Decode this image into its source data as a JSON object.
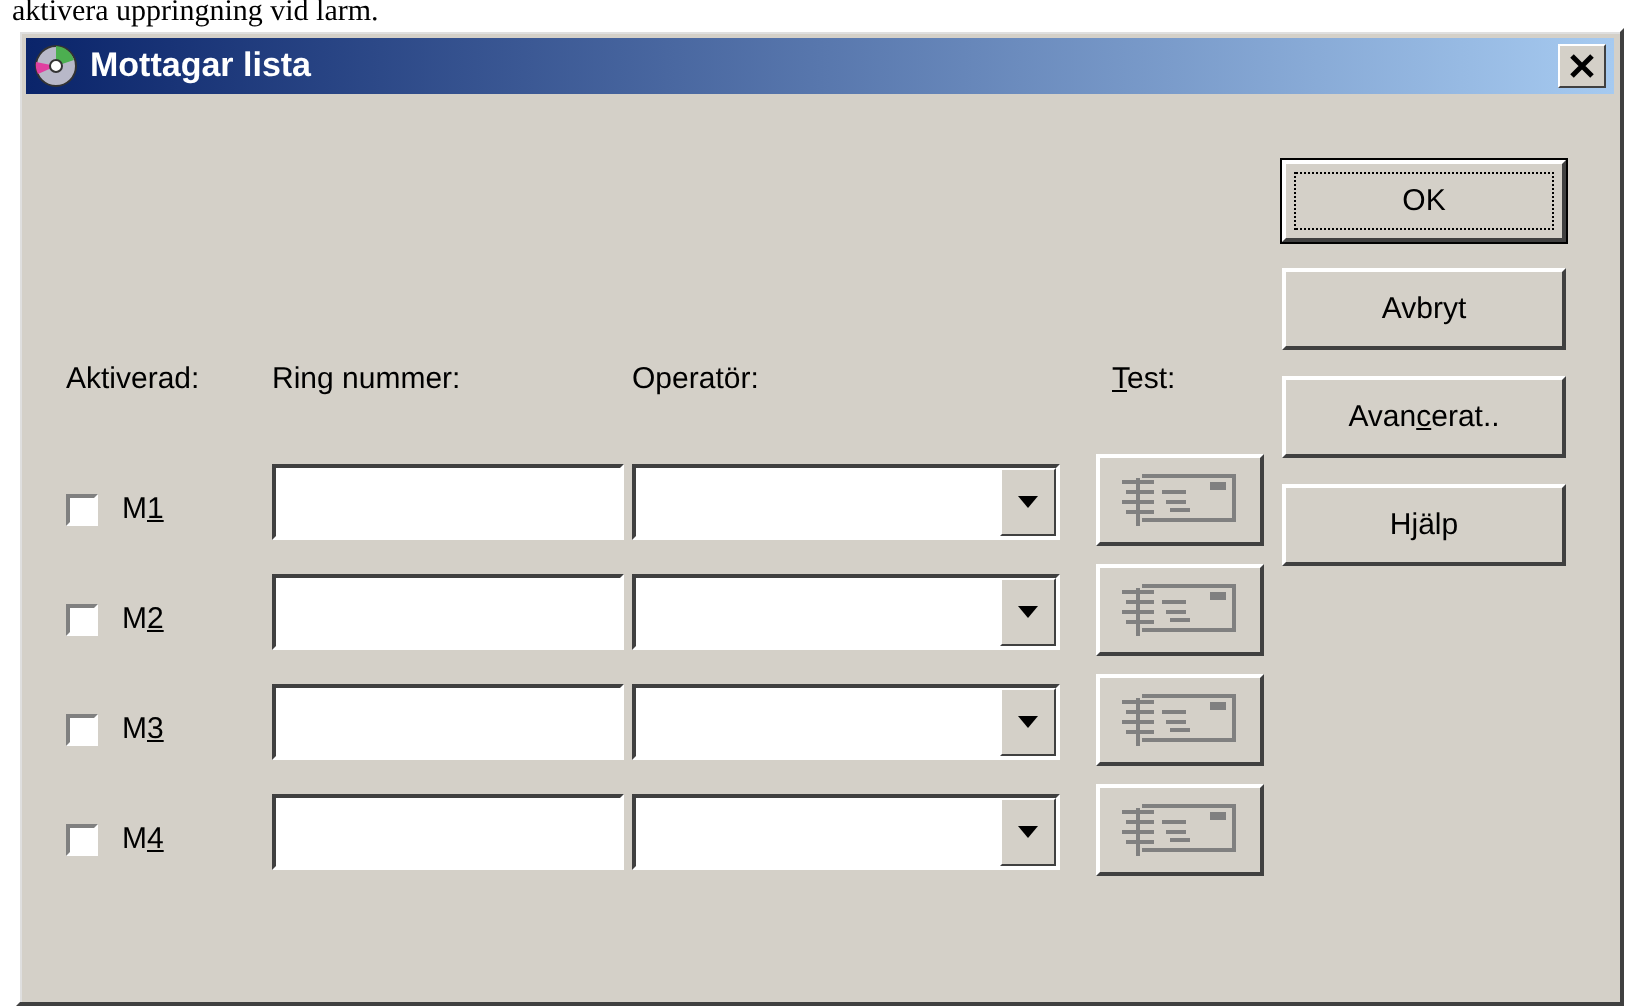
{
  "caption_above": "aktivera uppringning vid larm.",
  "window": {
    "title": "Mottagar lista"
  },
  "columns": [
    {
      "label_parts": [
        {
          "text": "Aktiverad:",
          "underlined": false
        }
      ]
    },
    {
      "label_parts": [
        {
          "text": "Ring nummer:",
          "underlined": false
        }
      ]
    },
    {
      "label_parts": [
        {
          "text": "Operatör:",
          "underlined": false
        }
      ]
    },
    {
      "label_parts": [
        {
          "text": "T",
          "underlined": true
        },
        {
          "text": "est:",
          "underlined": false
        }
      ]
    }
  ],
  "rows": [
    {
      "checked": false,
      "label_parts": [
        {
          "text": "M",
          "underlined": false
        },
        {
          "text": "1",
          "underlined": true
        }
      ],
      "test_disabled": true
    },
    {
      "checked": false,
      "label_parts": [
        {
          "text": "M",
          "underlined": false
        },
        {
          "text": "2",
          "underlined": true
        }
      ],
      "test_disabled": true
    },
    {
      "checked": false,
      "label_parts": [
        {
          "text": "M",
          "underlined": false
        },
        {
          "text": "3",
          "underlined": true
        }
      ],
      "test_disabled": true
    },
    {
      "checked": false,
      "label_parts": [
        {
          "text": "M",
          "underlined": false
        },
        {
          "text": "4",
          "underlined": true
        }
      ],
      "test_disabled": true
    }
  ],
  "buttons": [
    {
      "default": true,
      "label_parts": [
        {
          "text": "OK",
          "underlined": false
        }
      ]
    },
    {
      "default": false,
      "label_parts": [
        {
          "text": "Avbryt",
          "underlined": false
        }
      ]
    },
    {
      "default": false,
      "label_parts": [
        {
          "text": "Avan",
          "underlined": false
        },
        {
          "text": "c",
          "underlined": true
        },
        {
          "text": "erat..",
          "underlined": false
        }
      ]
    },
    {
      "default": false,
      "label_parts": [
        {
          "text": "Hjälp",
          "underlined": false
        }
      ]
    }
  ]
}
